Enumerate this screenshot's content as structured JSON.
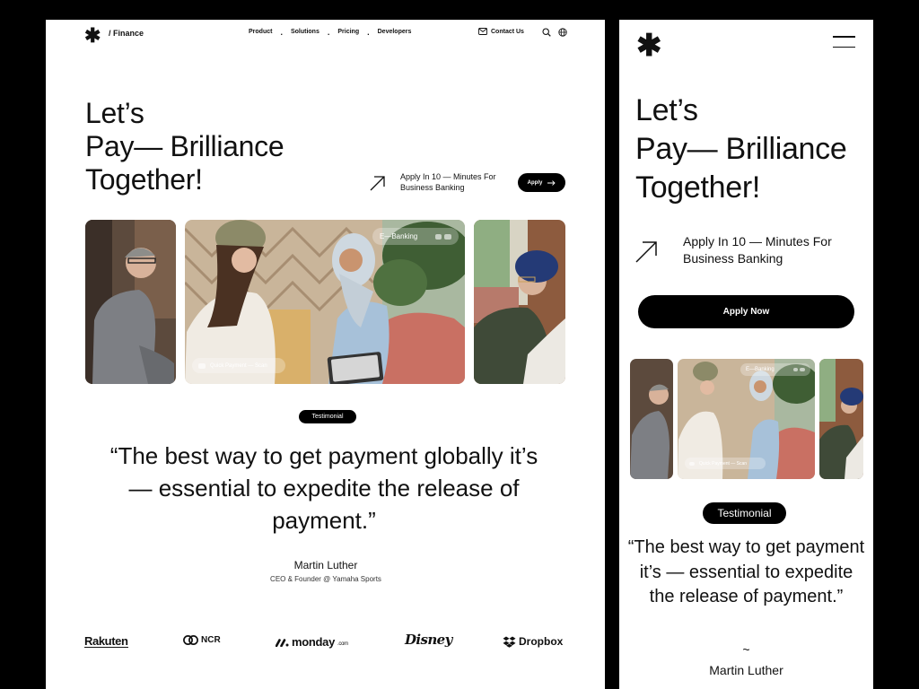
{
  "desktop": {
    "brand": "/ Finance",
    "nav": [
      "Product",
      "Solutions",
      "Pricing",
      "Developers"
    ],
    "contact": "Contact Us",
    "hero": {
      "line1": "Let’s",
      "line2": "Pay— Brilliance",
      "line3": "Together!"
    },
    "apply_text": "Apply In 10 — Minutes For Business Banking",
    "apply_button": "Apply",
    "photo_tag_top": "E—Banking",
    "photo_tag_bottom": "Quick Payment — Scan",
    "badge": "Testimonial",
    "quote": "“The best way to get payment globally it’s — essential to expedite the release of payment.”",
    "author": "Martin Luther",
    "role": "CEO & Founder @ Yamaha Sports",
    "logos": {
      "rakuten": "Rakuten",
      "ncr": "NCR",
      "monday": "monday",
      "monday_suffix": ".com",
      "disney": "Disney",
      "dropbox": "Dropbox"
    }
  },
  "mobile": {
    "hero": {
      "line1": "Let’s",
      "line2": "Pay— Brilliance",
      "line3": "Together!"
    },
    "apply_text": "Apply In 10 — Minutes For Business Banking",
    "apply_button": "Apply Now",
    "photo_tag_top": "E—Banking",
    "photo_tag_bottom": "Quick Payment — Scan",
    "badge": "Testimonial",
    "quote": "“The best way to get payment  it’s — essential to expedite  the release of payment.”",
    "tilde": "~",
    "author": "Martin Luther"
  },
  "colors": {
    "background": "#000000",
    "surface": "#ffffff",
    "text": "#111111",
    "accent": "#000000"
  },
  "icons": [
    "asterisk-logo-icon",
    "mail-icon",
    "search-icon",
    "globe-icon",
    "arrow-up-right-icon",
    "arrow-right-icon",
    "menu-icon"
  ]
}
